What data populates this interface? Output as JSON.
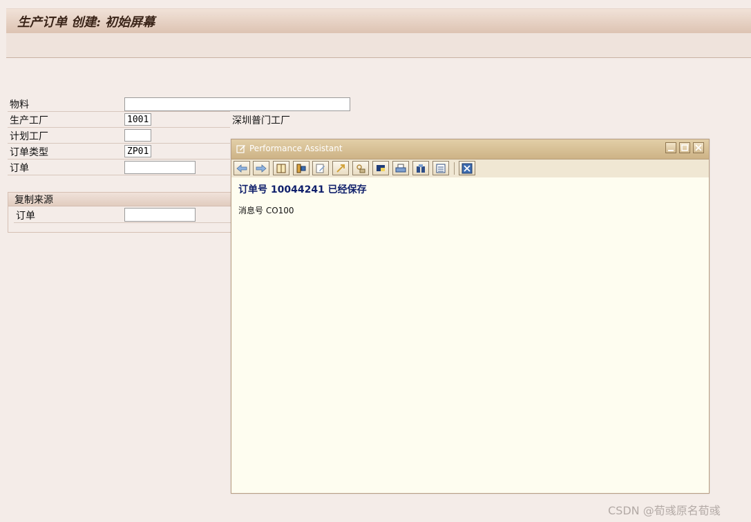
{
  "screen": {
    "title": "生产订单 创建: 初始屏幕"
  },
  "form": {
    "material_label": "物料",
    "material_value": "",
    "plant_label": "生产工厂",
    "plant_value": "1001",
    "plant_description": "深圳普门工厂",
    "planning_plant_label": "计划工厂",
    "planning_plant_value": "",
    "order_type_label": "订单类型",
    "order_type_value": "ZP01",
    "order_label": "订单",
    "order_value": ""
  },
  "copy_from": {
    "title": "复制来源",
    "order_label": "订单",
    "order_value": ""
  },
  "assistant": {
    "title": "Performance Assistant",
    "heading": "订单号 10044241 已经保存",
    "message": "消息号 CO100",
    "toolbar_icons": [
      "back-arrow-icon",
      "forward-arrow-icon",
      "book-icon",
      "technical-info-icon",
      "edit-icon",
      "expand-icon",
      "settings-icon",
      "tag-icon",
      "print-icon",
      "find-icon",
      "list-icon",
      "close-x-icon"
    ]
  },
  "watermark": "CSDN @荀彧原名荀彧",
  "colors": {
    "background": "#f4ece8",
    "dialog_bg": "#fefdf0",
    "dialog_titlebar": "#cdb386",
    "heading_text": "#10206b"
  }
}
